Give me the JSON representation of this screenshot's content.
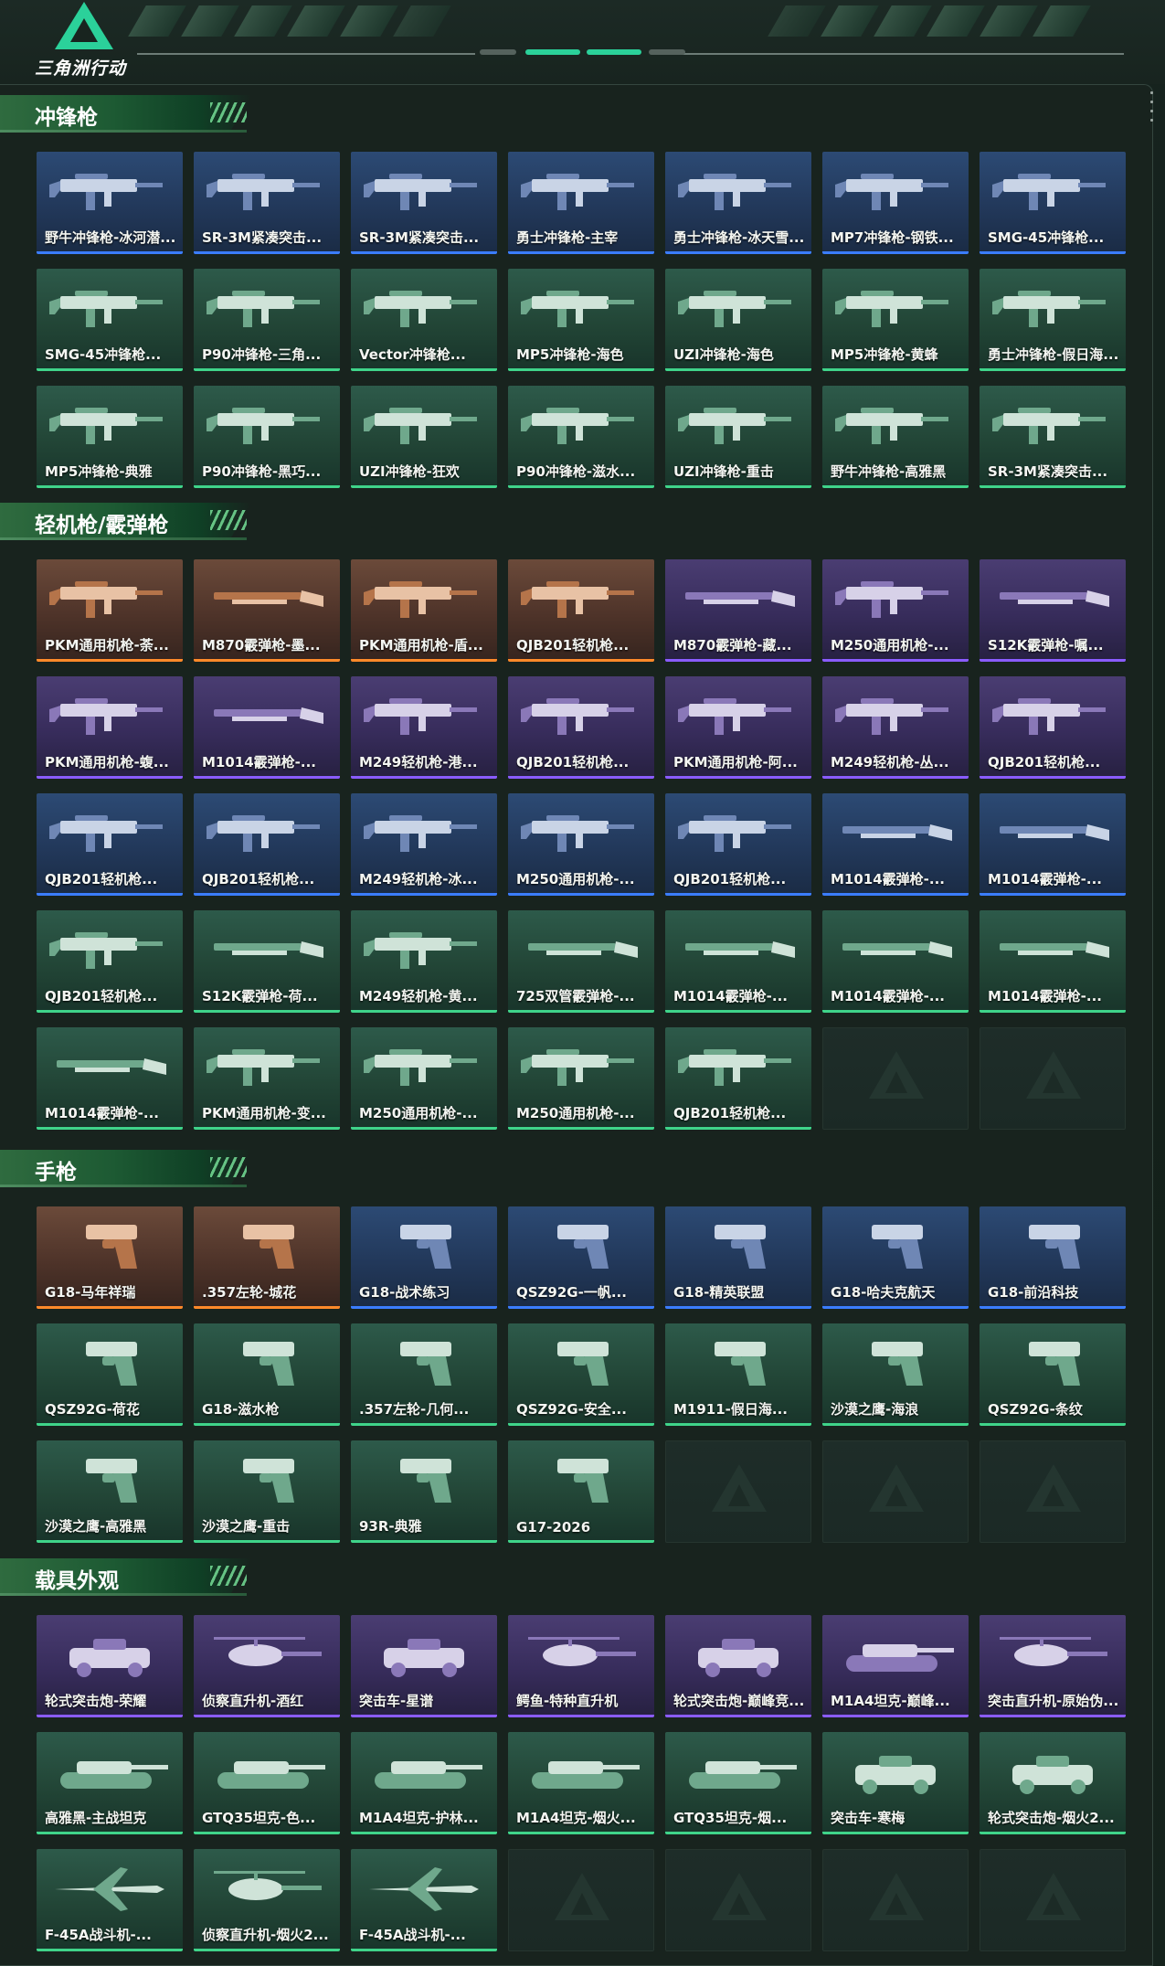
{
  "header": {
    "logo_text": "三角洲行动",
    "colors": {
      "accent": "#2bd19a",
      "panel_border": "#34463f"
    }
  },
  "sections": [
    {
      "title": "冲锋枪",
      "items": [
        {
          "label": "野牛冲锋枪-冰河潜...",
          "rarity": "blue",
          "icon": "smg-icon"
        },
        {
          "label": "SR-3M紧凑突击...",
          "rarity": "blue",
          "icon": "smg-icon"
        },
        {
          "label": "SR-3M紧凑突击...",
          "rarity": "blue",
          "icon": "smg-icon"
        },
        {
          "label": "勇士冲锋枪-主宰",
          "rarity": "blue",
          "icon": "smg-icon"
        },
        {
          "label": "勇士冲锋枪-冰天雪...",
          "rarity": "blue",
          "icon": "smg-icon"
        },
        {
          "label": "MP7冲锋枪-钢铁...",
          "rarity": "blue",
          "icon": "smg-icon"
        },
        {
          "label": "SMG-45冲锋枪...",
          "rarity": "blue",
          "icon": "smg-icon"
        },
        {
          "label": "SMG-45冲锋枪...",
          "rarity": "green",
          "icon": "smg-icon"
        },
        {
          "label": "P90冲锋枪-三角...",
          "rarity": "green",
          "icon": "smg-icon"
        },
        {
          "label": "Vector冲锋枪...",
          "rarity": "green",
          "icon": "smg-icon"
        },
        {
          "label": "MP5冲锋枪-海色",
          "rarity": "green",
          "icon": "smg-icon"
        },
        {
          "label": "UZI冲锋枪-海色",
          "rarity": "green",
          "icon": "smg-icon"
        },
        {
          "label": "MP5冲锋枪-黄蜂",
          "rarity": "green",
          "icon": "smg-icon"
        },
        {
          "label": "勇士冲锋枪-假日海...",
          "rarity": "green",
          "icon": "smg-icon"
        },
        {
          "label": "MP5冲锋枪-典雅",
          "rarity": "green",
          "icon": "smg-icon"
        },
        {
          "label": "P90冲锋枪-黑巧...",
          "rarity": "green",
          "icon": "smg-icon"
        },
        {
          "label": "UZI冲锋枪-狂欢",
          "rarity": "green",
          "icon": "smg-icon"
        },
        {
          "label": "P90冲锋枪-滋水...",
          "rarity": "green",
          "icon": "smg-icon"
        },
        {
          "label": "UZI冲锋枪-重击",
          "rarity": "green",
          "icon": "smg-icon"
        },
        {
          "label": "野牛冲锋枪-高雅黑",
          "rarity": "green",
          "icon": "smg-icon"
        },
        {
          "label": "SR-3M紧凑突击...",
          "rarity": "green",
          "icon": "smg-icon"
        }
      ],
      "empty_slots": 0
    },
    {
      "title": "轻机枪/霰弹枪",
      "items": [
        {
          "label": "PKM通用机枪-荼...",
          "rarity": "orange",
          "icon": "lmg-icon"
        },
        {
          "label": "M870霰弹枪-墨...",
          "rarity": "orange",
          "icon": "shotgun-icon"
        },
        {
          "label": "PKM通用机枪-盾...",
          "rarity": "orange",
          "icon": "lmg-icon"
        },
        {
          "label": "QJB201轻机枪...",
          "rarity": "orange",
          "icon": "lmg-icon"
        },
        {
          "label": "M870霰弹枪-藏...",
          "rarity": "purple",
          "icon": "shotgun-icon"
        },
        {
          "label": "M250通用机枪-...",
          "rarity": "purple",
          "icon": "lmg-icon"
        },
        {
          "label": "S12K霰弹枪-嘱...",
          "rarity": "purple",
          "icon": "shotgun-icon"
        },
        {
          "label": "PKM通用机枪-蝮...",
          "rarity": "purple",
          "icon": "lmg-icon"
        },
        {
          "label": "M1014霰弹枪-...",
          "rarity": "purple",
          "icon": "shotgun-icon"
        },
        {
          "label": "M249轻机枪-港...",
          "rarity": "purple",
          "icon": "lmg-icon"
        },
        {
          "label": "QJB201轻机枪...",
          "rarity": "purple",
          "icon": "lmg-icon"
        },
        {
          "label": "PKM通用机枪-阿...",
          "rarity": "purple",
          "icon": "lmg-icon"
        },
        {
          "label": "M249轻机枪-丛...",
          "rarity": "purple",
          "icon": "lmg-icon"
        },
        {
          "label": "QJB201轻机枪...",
          "rarity": "purple",
          "icon": "lmg-icon"
        },
        {
          "label": "QJB201轻机枪...",
          "rarity": "blue",
          "icon": "lmg-icon"
        },
        {
          "label": "QJB201轻机枪...",
          "rarity": "blue",
          "icon": "lmg-icon"
        },
        {
          "label": "M249轻机枪-冰...",
          "rarity": "blue",
          "icon": "lmg-icon"
        },
        {
          "label": "M250通用机枪-...",
          "rarity": "blue",
          "icon": "lmg-icon"
        },
        {
          "label": "QJB201轻机枪...",
          "rarity": "blue",
          "icon": "lmg-icon"
        },
        {
          "label": "M1014霰弹枪-...",
          "rarity": "blue",
          "icon": "shotgun-icon"
        },
        {
          "label": "M1014霰弹枪-...",
          "rarity": "blue",
          "icon": "shotgun-icon"
        },
        {
          "label": "QJB201轻机枪...",
          "rarity": "green",
          "icon": "lmg-icon"
        },
        {
          "label": "S12K霰弹枪-荷...",
          "rarity": "green",
          "icon": "shotgun-icon"
        },
        {
          "label": "M249轻机枪-黄...",
          "rarity": "green",
          "icon": "lmg-icon"
        },
        {
          "label": "725双管霰弹枪-...",
          "rarity": "green",
          "icon": "shotgun-icon"
        },
        {
          "label": "M1014霰弹枪-...",
          "rarity": "green",
          "icon": "shotgun-icon"
        },
        {
          "label": "M1014霰弹枪-...",
          "rarity": "green",
          "icon": "shotgun-icon"
        },
        {
          "label": "M1014霰弹枪-...",
          "rarity": "green",
          "icon": "shotgun-icon"
        },
        {
          "label": "M1014霰弹枪-...",
          "rarity": "green",
          "icon": "shotgun-icon"
        },
        {
          "label": "PKM通用机枪-变...",
          "rarity": "green",
          "icon": "lmg-icon"
        },
        {
          "label": "M250通用机枪-...",
          "rarity": "green",
          "icon": "lmg-icon"
        },
        {
          "label": "M250通用机枪-...",
          "rarity": "green",
          "icon": "lmg-icon"
        },
        {
          "label": "QJB201轻机枪...",
          "rarity": "green",
          "icon": "lmg-icon"
        }
      ],
      "empty_slots": 2
    },
    {
      "title": "手枪",
      "items": [
        {
          "label": "G18-马年祥瑞",
          "rarity": "orange",
          "icon": "pistol-icon"
        },
        {
          "label": ".357左轮-城花",
          "rarity": "orange",
          "icon": "revolver-icon"
        },
        {
          "label": "G18-战术练习",
          "rarity": "blue",
          "icon": "pistol-icon"
        },
        {
          "label": "QSZ92G-一帆...",
          "rarity": "blue",
          "icon": "pistol-icon"
        },
        {
          "label": "G18-精英联盟",
          "rarity": "blue",
          "icon": "pistol-icon"
        },
        {
          "label": "G18-哈夫克航天",
          "rarity": "blue",
          "icon": "pistol-icon"
        },
        {
          "label": "G18-前沿科技",
          "rarity": "blue",
          "icon": "pistol-icon"
        },
        {
          "label": "QSZ92G-荷花",
          "rarity": "green",
          "icon": "pistol-icon"
        },
        {
          "label": "G18-滋水枪",
          "rarity": "green",
          "icon": "pistol-icon"
        },
        {
          "label": ".357左轮-几何...",
          "rarity": "green",
          "icon": "revolver-icon"
        },
        {
          "label": "QSZ92G-安全...",
          "rarity": "green",
          "icon": "pistol-icon"
        },
        {
          "label": "M1911-假日海...",
          "rarity": "green",
          "icon": "pistol-icon"
        },
        {
          "label": "沙漠之鹰-海浪",
          "rarity": "green",
          "icon": "pistol-icon"
        },
        {
          "label": "QSZ92G-条纹",
          "rarity": "green",
          "icon": "pistol-icon"
        },
        {
          "label": "沙漠之鹰-高雅黑",
          "rarity": "green",
          "icon": "pistol-icon"
        },
        {
          "label": "沙漠之鹰-重击",
          "rarity": "green",
          "icon": "pistol-icon"
        },
        {
          "label": "93R-典雅",
          "rarity": "green",
          "icon": "pistol-icon"
        },
        {
          "label": "G17-2026",
          "rarity": "green",
          "icon": "pistol-icon"
        }
      ],
      "empty_slots": 3
    },
    {
      "title": "载具外观",
      "items": [
        {
          "label": "轮式突击炮-荣耀",
          "rarity": "purple",
          "icon": "vehicle-icon"
        },
        {
          "label": "侦察直升机-酒红",
          "rarity": "purple",
          "icon": "helicopter-icon"
        },
        {
          "label": "突击车-星谱",
          "rarity": "purple",
          "icon": "vehicle-icon"
        },
        {
          "label": "鳄鱼-特种直升机",
          "rarity": "purple",
          "icon": "helicopter-icon"
        },
        {
          "label": "轮式突击炮-巅峰竞...",
          "rarity": "purple",
          "icon": "vehicle-icon"
        },
        {
          "label": "M1A4坦克-巅峰...",
          "rarity": "purple",
          "icon": "tank-icon"
        },
        {
          "label": "突击直升机-原始伪...",
          "rarity": "purple",
          "icon": "helicopter-icon"
        },
        {
          "label": "高雅黑-主战坦克",
          "rarity": "green",
          "icon": "tank-icon"
        },
        {
          "label": "GTQ35坦克-色...",
          "rarity": "green",
          "icon": "tank-icon"
        },
        {
          "label": "M1A4坦克-护林...",
          "rarity": "green",
          "icon": "tank-icon"
        },
        {
          "label": "M1A4坦克-烟火...",
          "rarity": "green",
          "icon": "tank-icon"
        },
        {
          "label": "GTQ35坦克-烟...",
          "rarity": "green",
          "icon": "tank-icon"
        },
        {
          "label": "突击车-寒梅",
          "rarity": "green",
          "icon": "vehicle-icon"
        },
        {
          "label": "轮式突击炮-烟火2...",
          "rarity": "green",
          "icon": "vehicle-icon"
        },
        {
          "label": "F-45A战斗机-...",
          "rarity": "green",
          "icon": "jet-icon"
        },
        {
          "label": "侦察直升机-烟火2...",
          "rarity": "green",
          "icon": "helicopter-icon"
        },
        {
          "label": "F-45A战斗机-...",
          "rarity": "green",
          "icon": "jet-icon"
        }
      ],
      "empty_slots": 4
    }
  ]
}
